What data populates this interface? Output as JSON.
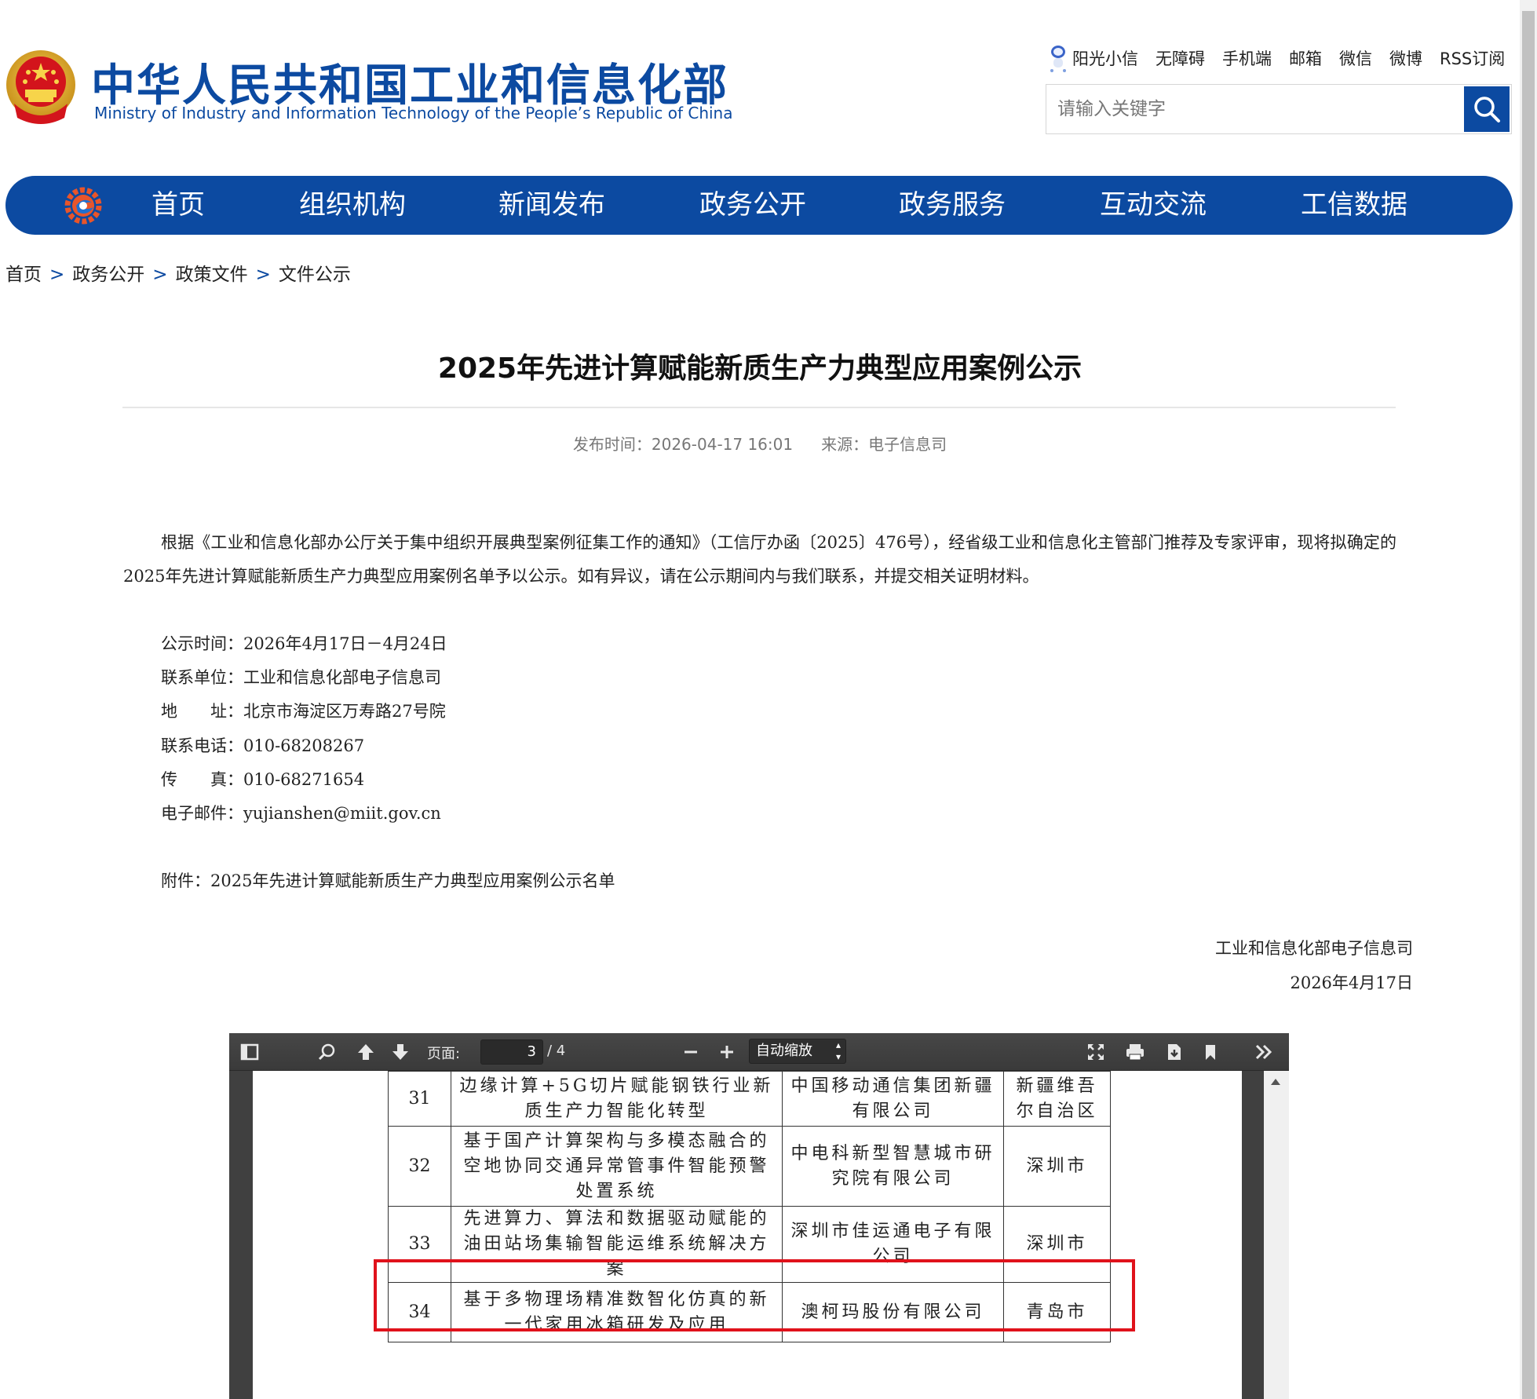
{
  "header": {
    "title_cn": "中华人民共和国工业和信息化部",
    "title_en": "Ministry of Industry and Information Technology of the People’s Republic of China",
    "top_links": [
      "阳光小信",
      "无障碍",
      "手机端",
      "邮箱",
      "微信",
      "微博",
      "RSS订阅"
    ],
    "search": {
      "placeholder": "请输入关键字",
      "value": ""
    }
  },
  "nav": {
    "items": [
      "首页",
      "组织机构",
      "新闻发布",
      "政务公开",
      "政务服务",
      "互动交流",
      "工信数据"
    ]
  },
  "breadcrumb": [
    "首页",
    "政务公开",
    "政策文件",
    "文件公示"
  ],
  "article": {
    "title": "2025年先进计算赋能新质生产力典型应用案例公示",
    "publish_time": "发布时间：2026-04-17 16:01",
    "source": "来源：电子信息司",
    "intro": "根据《工业和信息化部办公厅关于集中组织开展典型案例征集工作的通知》（工信厅办函〔2025〕476号），经省级工业和信息化主管部门推荐及专家评审，现将拟确定的2025年先进计算赋能新质生产力典型应用案例名单予以公示。如有异议，请在公示期间内与我们联系，并提交相关证明材料。",
    "info": [
      "公示时间：2026年4月17日－4月24日",
      "联系单位：工业和信息化部电子信息司",
      "地　　址：北京市海淀区万寿路27号院",
      "联系电话：010-68208267",
      "传　　真：010-68271654",
      "电子邮件：yujianshen@miit.gov.cn"
    ],
    "attachment": "附件：2025年先进计算赋能新质生产力典型应用案例公示名单",
    "signature_dept": "工业和信息化部电子信息司",
    "signature_date": "2026年4月17日"
  },
  "pdf_viewer": {
    "page_label": "页面:",
    "current_page": "3",
    "total_pages": "/ 4",
    "zoom": "自动缩放",
    "table_rows": [
      {
        "no": "31",
        "case": "边缘计算+5G切片赋能钢铁行业新质生产力智能化转型",
        "unit": "中国移动通信集团新疆有限公司",
        "region": "新疆维吾尔自治区"
      },
      {
        "no": "32",
        "case": "基于国产计算架构与多模态融合的空地协同交通异常管事件智能预警处置系统",
        "unit": "中电科新型智慧城市研究院有限公司",
        "region": "深圳市"
      },
      {
        "no": "33",
        "case": "先进算力、算法和数据驱动赋能的油田站场集输智能运维系统解决方案",
        "unit": "深圳市佳运通电子有限公司",
        "region": "深圳市"
      },
      {
        "no": "34",
        "case": "基于多物理场精准数智化仿真的新一代家用冰箱研发及应用",
        "unit": "澳柯玛股份有限公司",
        "region": "青岛市"
      }
    ]
  },
  "colors": {
    "brand_blue": "#0c4aa1",
    "highlight_red": "#e0121b"
  }
}
